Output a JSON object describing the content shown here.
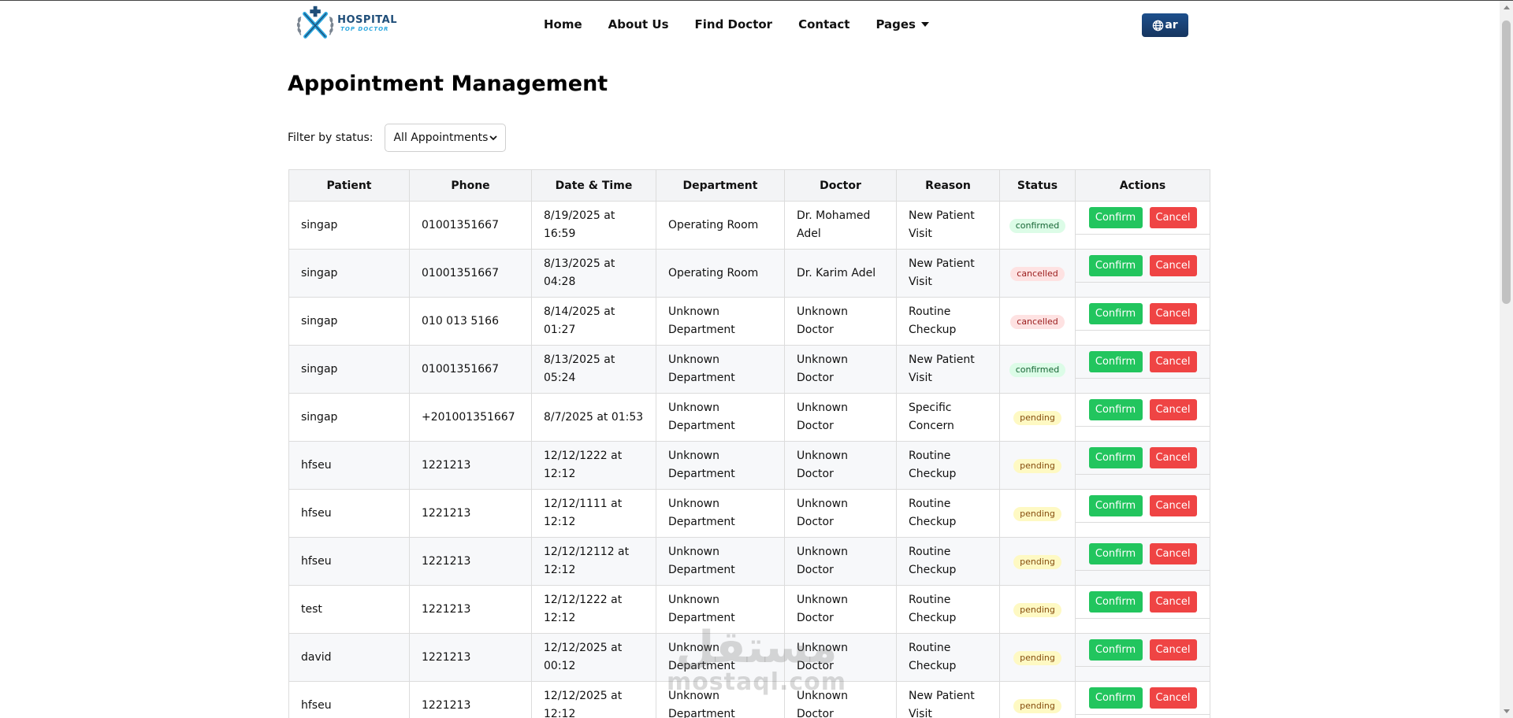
{
  "logo": {
    "line1": "HOSPITAL",
    "line2": "TOP DOCTOR"
  },
  "nav": {
    "items": [
      "Home",
      "About Us",
      "Find Doctor",
      "Contact"
    ],
    "pages_label": "Pages"
  },
  "language": {
    "label": "ar",
    "icon": "globe-icon"
  },
  "page": {
    "title": "Appointment Management"
  },
  "filter": {
    "label": "Filter by status:",
    "selected": "All Appointments"
  },
  "table": {
    "headers": [
      "Patient",
      "Phone",
      "Date & Time",
      "Department",
      "Doctor",
      "Reason",
      "Status",
      "Actions"
    ],
    "confirm_label": "Confirm",
    "cancel_label": "Cancel",
    "rows": [
      {
        "patient": "singap",
        "phone": "01001351667",
        "datetime": "8/19/2025 at 16:59",
        "department": "Operating Room",
        "doctor": "Dr. Mohamed Adel",
        "reason": "New Patient Visit",
        "status": "confirmed"
      },
      {
        "patient": "singap",
        "phone": "01001351667",
        "datetime": "8/13/2025 at 04:28",
        "department": "Operating Room",
        "doctor": "Dr. Karim Adel",
        "reason": "New Patient Visit",
        "status": "cancelled"
      },
      {
        "patient": "singap",
        "phone": "010 013 5166",
        "datetime": "8/14/2025 at 01:27",
        "department": "Unknown Department",
        "doctor": "Unknown Doctor",
        "reason": "Routine Checkup",
        "status": "cancelled"
      },
      {
        "patient": "singap",
        "phone": "01001351667",
        "datetime": "8/13/2025 at 05:24",
        "department": "Unknown Department",
        "doctor": "Unknown Doctor",
        "reason": "New Patient Visit",
        "status": "confirmed"
      },
      {
        "patient": "singap",
        "phone": "+201001351667",
        "datetime": "8/7/2025 at 01:53",
        "department": "Unknown Department",
        "doctor": "Unknown Doctor",
        "reason": "Specific Concern",
        "status": "pending"
      },
      {
        "patient": "hfseu",
        "phone": "1221213",
        "datetime": "12/12/1222 at 12:12",
        "department": "Unknown Department",
        "doctor": "Unknown Doctor",
        "reason": "Routine Checkup",
        "status": "pending"
      },
      {
        "patient": "hfseu",
        "phone": "1221213",
        "datetime": "12/12/1111 at 12:12",
        "department": "Unknown Department",
        "doctor": "Unknown Doctor",
        "reason": "Routine Checkup",
        "status": "pending"
      },
      {
        "patient": "hfseu",
        "phone": "1221213",
        "datetime": "12/12/12112 at 12:12",
        "department": "Unknown Department",
        "doctor": "Unknown Doctor",
        "reason": "Routine Checkup",
        "status": "pending"
      },
      {
        "patient": "test",
        "phone": "1221213",
        "datetime": "12/12/1222 at 12:12",
        "department": "Unknown Department",
        "doctor": "Unknown Doctor",
        "reason": "Routine Checkup",
        "status": "pending"
      },
      {
        "patient": "david",
        "phone": "1221213",
        "datetime": "12/12/2025 at 00:12",
        "department": "Unknown Department",
        "doctor": "Unknown Doctor",
        "reason": "Routine Checkup",
        "status": "pending"
      },
      {
        "patient": "hfseu",
        "phone": "1221213",
        "datetime": "12/12/2025 at 12:12",
        "department": "Unknown Department",
        "doctor": "Unknown Doctor",
        "reason": "New Patient Visit",
        "status": "pending"
      }
    ]
  },
  "watermark": {
    "line1": "مستقل",
    "line2": "mostaql.com"
  },
  "colors": {
    "confirm": "#22c55e",
    "cancel": "#ef4444",
    "lang_button": "#1d4f8c",
    "confirmed_badge": "#dcfce7",
    "cancelled_badge": "#fee2e2",
    "pending_badge": "#fef9c3"
  }
}
